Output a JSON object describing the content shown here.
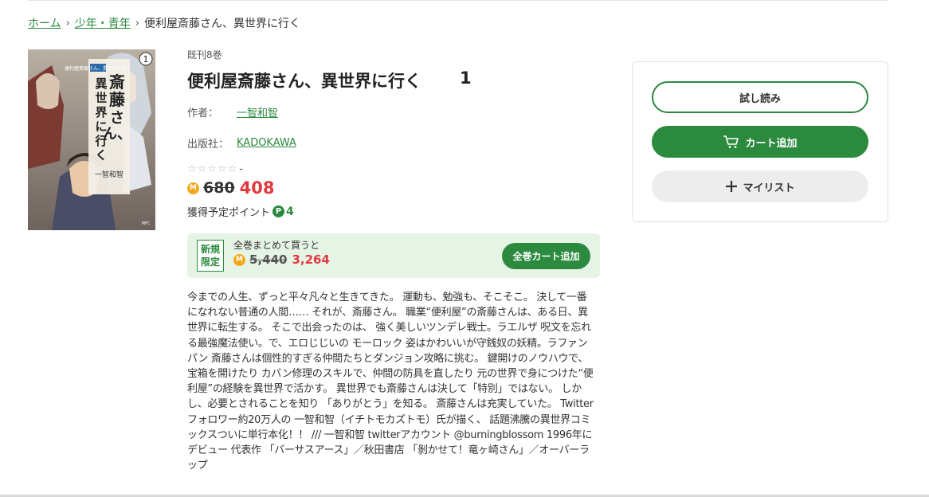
{
  "breadcrumb": {
    "home": "ホーム",
    "category": "少年・青年",
    "current": "便利屋斎藤さん、異世界に行く"
  },
  "cover": {
    "publisher_mark": "MFC",
    "volume": "1",
    "title_vertical": "便利屋斎藤さん、異世界に行く",
    "author": "一智和智"
  },
  "book": {
    "series_count": "既刊8巻",
    "title": "便利屋斎藤さん、異世界に行く",
    "volume": "1",
    "author_label": "作者：",
    "author": "一智和智",
    "publisher_label": "出版社：",
    "publisher": "KADOKAWA",
    "rating_stars": 0,
    "rating_text": "-",
    "coin_icon": "M",
    "price_original": "680",
    "price_sale": "408",
    "points_label": "獲得予定ポイント",
    "points_icon": "P",
    "points_value": "4"
  },
  "bundle": {
    "tag_line1": "新規",
    "tag_line2": "限定",
    "label": "全巻まとめて買うと",
    "price_original": "5,440",
    "price_sale": "3,264",
    "button_label": "全巻カート追加"
  },
  "description": "今までの人生、ずっと平々凡々と生きてきた。 運動も、勉強も、そこそこ。 決して一番になれない普通の人間…… それが、斎藤さん。 職業“便利屋”の斎藤さんは、ある日、異世界に転生する。 そこで出会ったのは、 強く美しいツンデレ戦士。ラエルザ 呪文を忘れる最強魔法使い。で、エロじじいの モーロック 姿はかわいいが守銭奴の妖精。ラファンパン 斎藤さんは個性的すぎる仲間たちとダンジョン攻略に挑む。 鍵開けのノウハウで、宝箱を開けたり カバン修理のスキルで、仲間の防具を直したり 元の世界で身につけた“便利屋”の経験を異世界で活かす。 異世界でも斎藤さんは決して「特別」ではない。 しかし、必要とされることを知り 「ありがとう」を知る。 斎藤さんは充実していた。 Twitterフォロワー約20万人の 一智和智（イチトモカズトモ）氏が描く、 話題沸騰の異世界コミックスついに単行本化！！ /// 一智和智 twitterアカウント @burningblossom 1996年にデビュー 代表作 「バーサスアース」／秋田書店 「剝かせて！竜ヶ崎さん」／オーバーラップ",
  "actions": {
    "try_read": "試し読み",
    "add_cart": "カート追加",
    "my_list": "マイリスト"
  },
  "colors": {
    "accent": "#2b8a3e",
    "sale": "#e0393e",
    "coin": "#f2a81d",
    "bundle_bg": "#e6f4e6"
  }
}
